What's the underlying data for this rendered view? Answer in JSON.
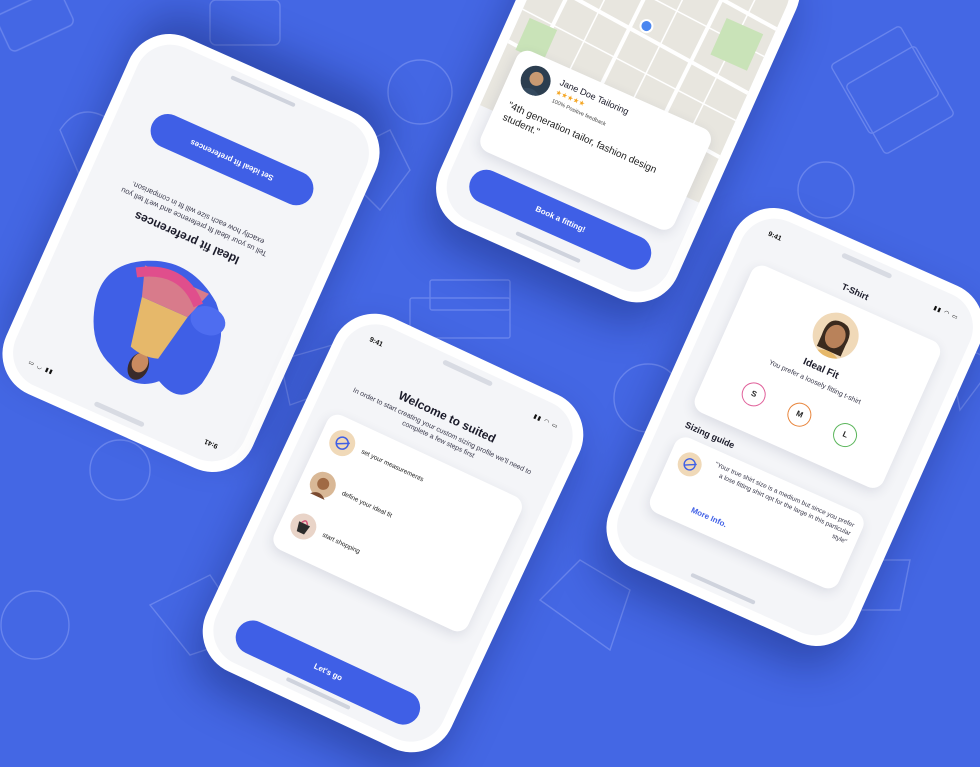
{
  "colors": {
    "background": "#4467E4",
    "accent": "#3F5FE6",
    "card": "#FFFFFF",
    "screen": "#F4F5F8",
    "size_s": "#E0609A",
    "size_m": "#E8853C",
    "size_l": "#5AB55A",
    "star": "#F5A623"
  },
  "phone1": {
    "button_label": "Set ideal fit preferences",
    "title": "Ideal fit preferences",
    "description": "Tell us your ideal fit preference and we'll tell you exactly how each size will fit in comparison.",
    "time": "9:41"
  },
  "phone2": {
    "tailor_name": "Jane Doe Tailoring",
    "rating_stars": "★★★★★",
    "feedback": "100% Positive feedback",
    "quote": "\"4th generation tailor, fashion design student.\"",
    "button_label": "Book a fitting!"
  },
  "phone3": {
    "time": "9:41",
    "title": "Welcome to suited",
    "description": "In order to start creating your custom sizing profile we'll need to complete a few steps first",
    "steps": [
      {
        "label": "set your measurements",
        "icon": "measuring-tape-icon"
      },
      {
        "label": "define your ideal fit",
        "icon": "person-avatar-icon"
      },
      {
        "label": "start shopping",
        "icon": "shopping-icon"
      }
    ],
    "button_label": "Let's go"
  },
  "phone4": {
    "time": "9:41",
    "header_title": "T-Shirt",
    "fit_title": "Ideal Fit",
    "fit_subtitle": "You prefer a loosely fitting t-shirt",
    "sizes": [
      "S",
      "M",
      "L"
    ],
    "guide_title": "Sizing guide",
    "guide_text": "\"Your true shirt size is a medium but since you prefer a lose fitting shirt opt for the large in this particular style\"",
    "more_info": "More Info."
  }
}
